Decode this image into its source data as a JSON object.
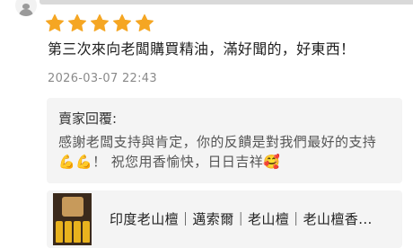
{
  "review": {
    "rating": 5,
    "max_rating": 5,
    "text": "第三次來向老闆購買精油，滿好聞的，好東西！",
    "timestamp": "2026-03-07 22:43"
  },
  "seller_reply": {
    "title": "賣家回覆:",
    "text": "感謝老闆支持與肯定，你的反饋是對我們最好的支持",
    "emoji_1": "💪",
    "emoji_2": "💪",
    "text_2": "！ 祝您用香愉快，日日吉祥",
    "emoji_3": "🥰"
  },
  "product": {
    "title": "印度老山檀｜邁索爾｜老山檀｜老山檀香..."
  },
  "colors": {
    "star": "#f5a623",
    "reply_bg": "#f4f4f4",
    "muted_text": "#8a8a8a"
  },
  "icons": {
    "avatar": "user-avatar-icon",
    "star": "star-icon"
  }
}
